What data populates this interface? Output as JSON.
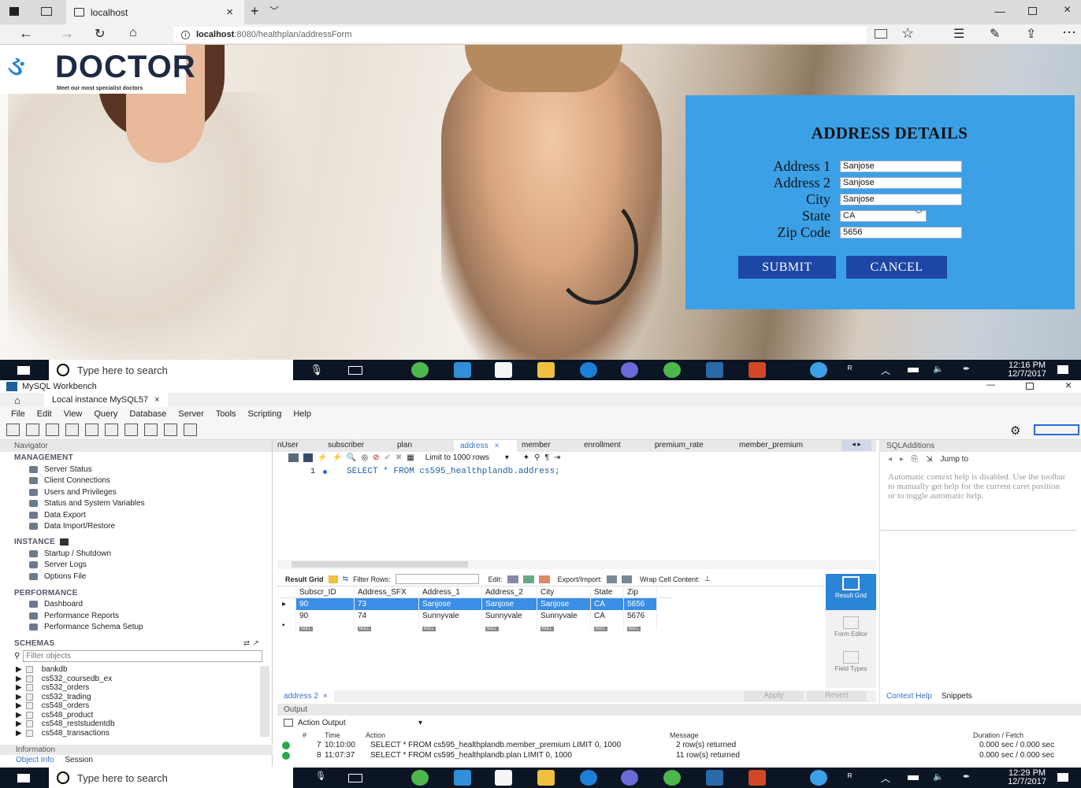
{
  "browser": {
    "tab_title": "localhost",
    "url_host": "localhost",
    "url_path": ":8080/healthplan/addressForm",
    "logo_text": "DOCTOR",
    "logo_tagline": "Meet our most specialist doctors"
  },
  "form": {
    "title": "ADDRESS DETAILS",
    "fields": [
      {
        "label": "Address 1",
        "value": "Sanjose"
      },
      {
        "label": "Address 2",
        "value": "Sanjose"
      },
      {
        "label": "City",
        "value": "Sanjose"
      },
      {
        "label": "State",
        "value": "CA"
      },
      {
        "label": "Zip Code",
        "value": "5656"
      }
    ],
    "submit_label": "SUBMIT",
    "cancel_label": "CANCEL",
    "panel_color": "#3ba0e6",
    "button_color": "#1d47a6"
  },
  "taskbar_top": {
    "search_placeholder": "Type here to search",
    "time": "12:16 PM",
    "date": "12/7/2017"
  },
  "taskbar_bottom": {
    "search_placeholder": "Type here to search",
    "time": "12:29 PM",
    "date": "12/7/2017"
  },
  "workbench": {
    "app_title": "MySQL Workbench",
    "instance_tab": "Local instance MySQL57",
    "menu": [
      "File",
      "Edit",
      "View",
      "Query",
      "Database",
      "Server",
      "Tools",
      "Scripting",
      "Help"
    ],
    "navigator_label": "Navigator",
    "management_label": "MANAGEMENT",
    "management_items": [
      "Server Status",
      "Client Connections",
      "Users and Privileges",
      "Status and System Variables",
      "Data Export",
      "Data Import/Restore"
    ],
    "instance_label": "INSTANCE",
    "instance_items": [
      "Startup / Shutdown",
      "Server Logs",
      "Options File"
    ],
    "performance_label": "PERFORMANCE",
    "performance_items": [
      "Dashboard",
      "Performance Reports",
      "Performance Schema Setup"
    ],
    "schemas_label": "SCHEMAS",
    "filter_placeholder": "Filter objects",
    "schemas": [
      "bankdb",
      "cs532_coursedb_ex",
      "cs532_orders",
      "cs532_trading",
      "cs548_orders",
      "cs548_product",
      "cs548_reststudentdb",
      "cs548_transactions"
    ],
    "information_label": "Information",
    "info_tabs": [
      "Object Info",
      "Session"
    ],
    "query_tabs": [
      "nUser",
      "subscriber",
      "plan",
      "address",
      "member",
      "enrollment",
      "premium_rate",
      "member_premium"
    ],
    "limit_label": "Limit to 1000 rows",
    "line_number": "1",
    "sql": "SELECT * FROM cs595_healthplandb.address;",
    "result_grid_label": "Result Grid",
    "filter_rows_label": "Filter Rows:",
    "edit_label": "Edit:",
    "export_label": "Export/Import:",
    "wrap_label": "Wrap Cell Content:",
    "columns": [
      "Subscr_ID",
      "Address_SFX",
      "Address_1",
      "Address_2",
      "City",
      "State",
      "Zip"
    ],
    "rows": [
      [
        "90",
        "73",
        "Sanjose",
        "Sanjose",
        "Sanjose",
        "CA",
        "5656"
      ],
      [
        "90",
        "74",
        "Sunnyvale",
        "Sunnyvale",
        "Sunnyvale",
        "CA",
        "5676"
      ]
    ],
    "null_label": "NULL",
    "side_buttons": [
      "Result Grid",
      "Form Editor",
      "Field Types"
    ],
    "result_tab": "address 2",
    "apply_label": "Apply",
    "revert_label": "Revert",
    "sql_additions_label": "SQLAdditions",
    "jump_to": "Jump to",
    "context_help": "Automatic context help is disabled. Use the toolbar to manually get help for the current caret position or to toggle automatic help.",
    "context_tabs": [
      "Context Help",
      "Snippets"
    ],
    "output_label": "Output",
    "action_output": "Action Output",
    "output_headers": [
      "#",
      "Time",
      "Action",
      "Message",
      "Duration / Fetch"
    ],
    "output_rows": [
      [
        "7",
        "10:10:00",
        "SELECT * FROM cs595_healthplandb.member_premium LIMIT 0, 1000",
        "2 row(s) returned",
        "0.000 sec / 0.000 sec"
      ],
      [
        "8",
        "11:07:37",
        "SELECT * FROM cs595_healthplandb.plan LIMIT 0, 1000",
        "11 row(s) returned",
        "0.000 sec / 0.000 sec"
      ]
    ]
  }
}
